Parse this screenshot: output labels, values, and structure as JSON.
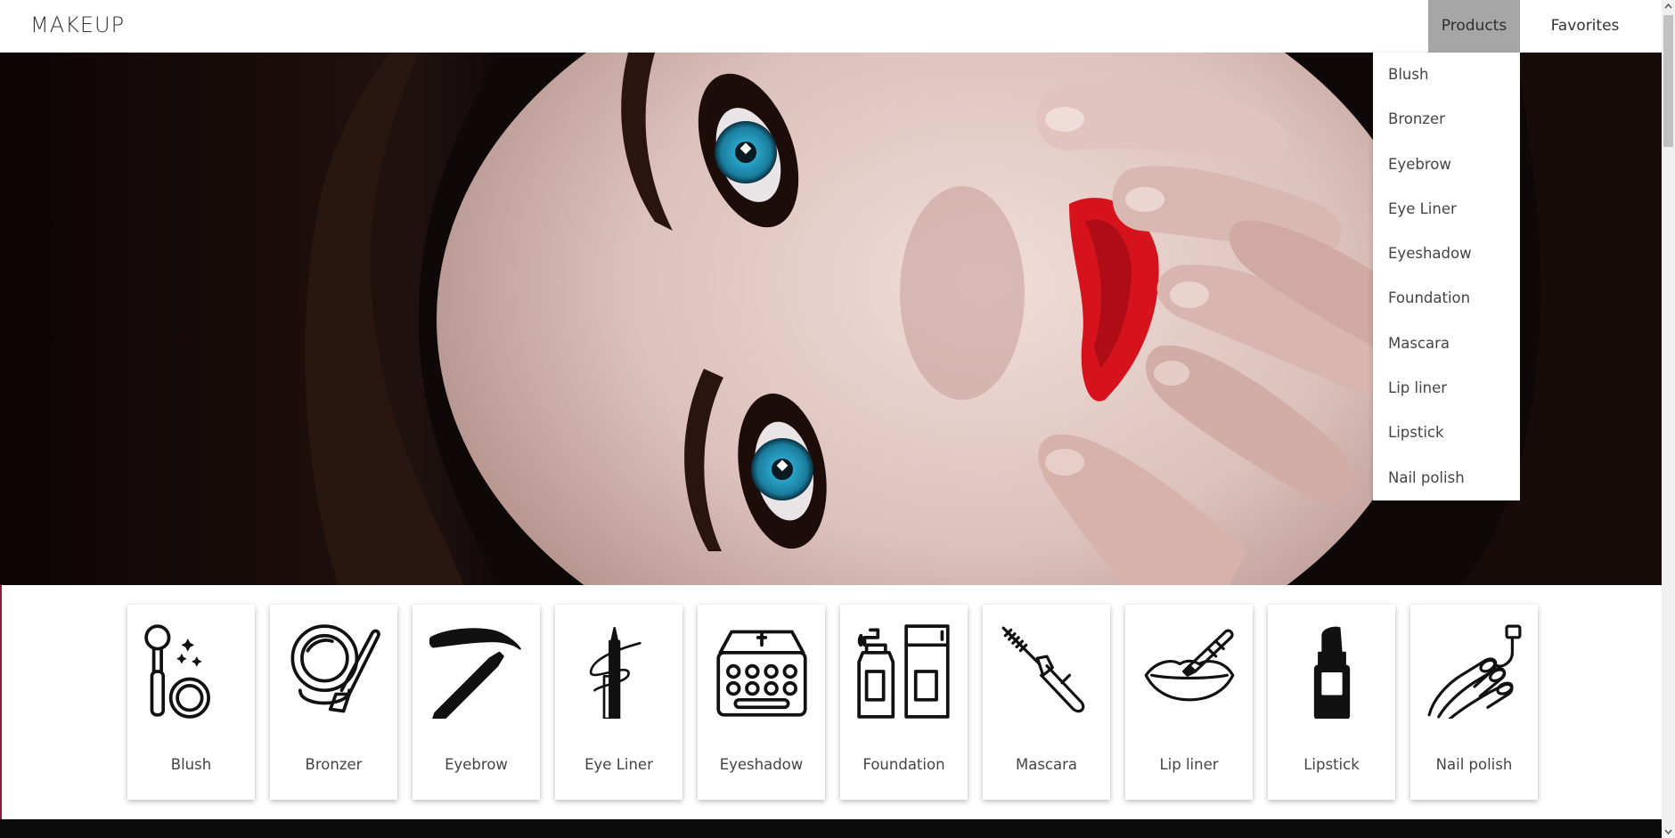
{
  "brand": "MAKEUP",
  "nav": {
    "products_label": "Products",
    "favorites_label": "Favorites"
  },
  "dropdown": {
    "items": [
      "Blush",
      "Bronzer",
      "Eyebrow",
      "Eye Liner",
      "Eyeshadow",
      "Foundation",
      "Mascara",
      "Lip liner",
      "Lipstick",
      "Nail polish"
    ]
  },
  "categories": [
    {
      "label": "Blush",
      "icon": "blush-brush-icon"
    },
    {
      "label": "Bronzer",
      "icon": "bronzer-compact-icon"
    },
    {
      "label": "Eyebrow",
      "icon": "eyebrow-pencil-icon"
    },
    {
      "label": "Eye Liner",
      "icon": "eye-liner-icon"
    },
    {
      "label": "Eyeshadow",
      "icon": "eyeshadow-palette-icon"
    },
    {
      "label": "Foundation",
      "icon": "foundation-bottle-icon"
    },
    {
      "label": "Mascara",
      "icon": "mascara-wand-icon"
    },
    {
      "label": "Lip liner",
      "icon": "lip-liner-icon"
    },
    {
      "label": "Lipstick",
      "icon": "lipstick-icon"
    },
    {
      "label": "Nail polish",
      "icon": "nail-polish-icon"
    }
  ],
  "colors": {
    "active_nav_bg": "#a6a6a6",
    "footer": "#0b0b0b",
    "lip_red": "#d6121c",
    "eye_blue": "#2aa3c8"
  }
}
